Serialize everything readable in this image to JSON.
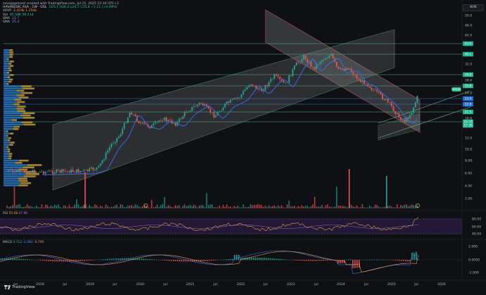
{
  "header": {
    "credit": "savegigamest created with TradingView.com, Jul 21, 2025 15:10 UTC+2",
    "symbol": "HAVAKEDIC ASA · 1W · OSL",
    "ohlc": "O25.1  H26.0  L24.7  C25.8  +1.11 (+4.49%)",
    "vrvp_label": "VRVP",
    "vrvp_values": "2.424k  1.254k",
    "vol_label": "Vol",
    "vol_values": "95.58K  56.214",
    "sma1_label": "SMA",
    "sma1_value": "21.7",
    "sma2_label": "SMA",
    "sma2_value": "25.4"
  },
  "currency_button": "NOK",
  "price_axis": {
    "ticks": [
      "50.0",
      "46.0",
      "42.0",
      "38.0",
      "36.0",
      "32.0",
      "30.0",
      "28.0",
      "26.0",
      "24.0",
      "22.0",
      "20.0",
      "18.0",
      "16.0",
      "14.0",
      "12.0",
      "10.0",
      "8.00",
      "6.00",
      "4.00",
      "2.00"
    ],
    "labels": [
      {
        "text": "43.6",
        "color": "#1fb58f"
      },
      {
        "text": "40.1",
        "color": "#1fb58f"
      },
      {
        "text": "34.8",
        "color": "#1fb58f"
      },
      {
        "text": "25.8",
        "color": "#1fb58f"
      },
      {
        "text": "23.4",
        "color": "#1f6ed4"
      },
      {
        "text": "22.9",
        "color": "#1f6ed4"
      },
      {
        "text": "21.5",
        "color": "#1fb58f"
      },
      {
        "text": "19.70",
        "color": "#1fb58f"
      },
      {
        "text": "17.30",
        "color": "#1fb58f"
      }
    ],
    "last_symbol": "HAVAK",
    "last_price": "25.8"
  },
  "rsi": {
    "label": "RSI",
    "value1": "55.08",
    "value2": "47.90",
    "ticks": [
      "80.00",
      "60.00",
      "40.00"
    ]
  },
  "macd": {
    "label": "MACD",
    "value1": "0.712",
    "value2": "-0.082",
    "value3": "-0.795",
    "ticks": [
      "2.000",
      "0.0000",
      "-2.000"
    ]
  },
  "time_axis": [
    "Jul",
    "2018",
    "Jul",
    "2019",
    "Jul",
    "2020",
    "Jul",
    "2021",
    "Jul",
    "2022",
    "Jul",
    "2023",
    "Jul",
    "2024",
    "Jul",
    "2025",
    "Jul",
    "2026",
    "Jul"
  ],
  "footer_brand": "TradingView",
  "colors": {
    "up": "#26a69a",
    "down": "#ef5350",
    "sma_blue": "#3b6ef5",
    "accent": "#1fb58f"
  }
}
